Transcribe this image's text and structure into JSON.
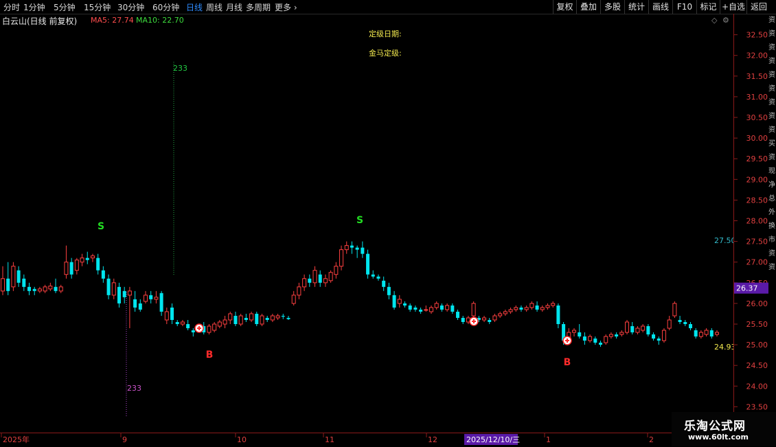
{
  "toolbar": {
    "periods": [
      "分时",
      "1分钟",
      "5分钟",
      "15分钟",
      "30分钟",
      "60分钟",
      "日线",
      "周线",
      "月线",
      "多周期",
      "更多"
    ],
    "active_period": "日线",
    "right_buttons": [
      "复权",
      "叠加",
      "多股",
      "统计",
      "画线",
      "F10",
      "标记",
      "+自选",
      "返回"
    ]
  },
  "info": {
    "title": "白云山(日线 前复权)",
    "ma5": "MA5: 27.74",
    "ma10": "MA10: 22.70"
  },
  "labels": {
    "rating_date": "定级日期:",
    "rating": "金马定级:"
  },
  "colors": {
    "up": "#ff4040",
    "down": "#00e5ee",
    "signal_s": "#22dd22",
    "signal_b": "#ff2a2a",
    "grid_axis": "#8b1a1a",
    "current_price_bg": "#5a1aa8"
  },
  "chart_data": {
    "type": "candlestick",
    "ylim": [
      23.0,
      32.7
    ],
    "y_ticks": [
      "32.50",
      "32.00",
      "31.50",
      "31.00",
      "30.50",
      "30.00",
      "29.50",
      "29.00",
      "28.50",
      "28.00",
      "27.50",
      "27.00",
      "26.50",
      "26.00",
      "25.50",
      "25.00",
      "24.50",
      "24.00",
      "23.50"
    ],
    "x_labels": [
      "2025年",
      "9",
      "10",
      "11",
      "12",
      "2025/12/10/三",
      "1",
      "2"
    ],
    "current_price": "26.37",
    "marker_high": "27.50",
    "marker_low": "24.93",
    "vline_labels": [
      "233",
      "233"
    ],
    "signals": [
      {
        "type": "S",
        "near": "2025-08 high"
      },
      {
        "type": "B",
        "near": "2025-09 low"
      },
      {
        "type": "S",
        "near": "2025-11 high"
      },
      {
        "type": "B",
        "near": "2026-01 low"
      }
    ],
    "candles": [
      [
        26.3,
        26.6,
        26.9,
        26.2
      ],
      [
        26.6,
        26.3,
        27.0,
        26.2
      ],
      [
        26.4,
        26.9,
        27.0,
        26.3
      ],
      [
        26.8,
        26.5,
        26.9,
        26.4
      ],
      [
        26.6,
        26.4,
        26.7,
        26.3
      ],
      [
        26.4,
        26.3,
        26.5,
        26.2
      ],
      [
        26.35,
        26.3,
        26.4,
        26.2
      ],
      [
        26.3,
        26.35,
        26.4,
        26.25
      ],
      [
        26.3,
        26.4,
        26.45,
        26.25
      ],
      [
        26.35,
        26.42,
        26.5,
        26.3
      ],
      [
        26.4,
        26.3,
        26.6,
        26.25
      ],
      [
        26.3,
        26.4,
        26.45,
        26.25
      ],
      [
        26.7,
        27.0,
        27.4,
        26.6
      ],
      [
        27.0,
        26.7,
        27.1,
        26.6
      ],
      [
        26.8,
        27.05,
        27.1,
        26.7
      ],
      [
        27.0,
        27.1,
        27.2,
        26.9
      ],
      [
        27.1,
        27.05,
        27.25,
        26.95
      ],
      [
        27.1,
        27.15,
        27.2,
        27.0
      ],
      [
        27.1,
        26.8,
        27.2,
        26.7
      ],
      [
        26.8,
        26.6,
        26.9,
        26.5
      ],
      [
        26.6,
        26.2,
        26.7,
        26.1
      ],
      [
        26.2,
        26.5,
        26.6,
        26.1
      ],
      [
        26.4,
        26.0,
        26.5,
        25.9
      ],
      [
        26.3,
        26.15,
        26.4,
        26.0
      ],
      [
        26.2,
        26.3,
        26.4,
        25.4
      ],
      [
        26.1,
        25.9,
        26.3,
        25.8
      ],
      [
        26.0,
        25.85,
        26.1,
        25.8
      ],
      [
        26.05,
        26.2,
        26.3,
        26.0
      ],
      [
        26.2,
        26.1,
        26.3,
        26.0
      ],
      [
        26.1,
        26.15,
        26.3,
        26.0
      ],
      [
        26.25,
        25.8,
        26.3,
        25.7
      ],
      [
        25.6,
        25.8,
        25.9,
        25.5
      ],
      [
        25.9,
        25.6,
        26.0,
        25.5
      ],
      [
        25.55,
        25.5,
        25.6,
        25.45
      ],
      [
        25.5,
        25.55,
        25.6,
        25.45
      ],
      [
        25.5,
        25.4,
        25.6,
        25.35
      ],
      [
        25.35,
        25.3,
        25.4,
        25.2
      ],
      [
        25.35,
        25.4,
        25.5,
        25.3
      ],
      [
        25.45,
        25.3,
        25.55,
        25.25
      ],
      [
        25.3,
        25.45,
        25.5,
        25.25
      ],
      [
        25.35,
        25.5,
        25.55,
        25.3
      ],
      [
        25.45,
        25.55,
        25.6,
        25.4
      ],
      [
        25.5,
        25.6,
        25.7,
        25.4
      ],
      [
        25.6,
        25.75,
        25.8,
        25.5
      ],
      [
        25.7,
        25.5,
        25.8,
        25.45
      ],
      [
        25.5,
        25.7,
        25.75,
        25.45
      ],
      [
        25.65,
        25.6,
        25.75,
        25.55
      ],
      [
        25.6,
        25.75,
        25.8,
        25.55
      ],
      [
        25.75,
        25.5,
        25.8,
        25.45
      ],
      [
        25.5,
        25.7,
        25.75,
        25.45
      ],
      [
        25.65,
        25.6,
        25.7,
        25.55
      ],
      [
        25.6,
        25.7,
        25.75,
        25.55
      ],
      [
        25.65,
        25.7,
        25.75,
        25.6
      ],
      [
        25.7,
        25.68,
        25.75,
        25.62
      ],
      [
        25.65,
        25.62,
        25.7,
        25.6
      ],
      [
        26.0,
        26.2,
        26.3,
        25.95
      ],
      [
        26.2,
        26.4,
        26.5,
        26.1
      ],
      [
        26.4,
        26.6,
        26.7,
        26.3
      ],
      [
        26.6,
        26.5,
        26.7,
        26.4
      ],
      [
        26.5,
        26.8,
        26.9,
        26.4
      ],
      [
        26.7,
        26.5,
        26.8,
        26.4
      ],
      [
        26.5,
        26.6,
        26.7,
        26.4
      ],
      [
        26.55,
        26.75,
        26.8,
        26.5
      ],
      [
        26.7,
        26.9,
        27.0,
        26.6
      ],
      [
        26.9,
        27.3,
        27.4,
        26.8
      ],
      [
        27.3,
        27.4,
        27.5,
        27.2
      ],
      [
        27.4,
        27.35,
        27.5,
        27.2
      ],
      [
        27.35,
        27.3,
        27.4,
        27.1
      ],
      [
        27.35,
        27.2,
        27.5,
        27.1
      ],
      [
        27.2,
        26.7,
        27.3,
        26.6
      ],
      [
        26.7,
        26.65,
        26.8,
        26.6
      ],
      [
        26.65,
        26.6,
        26.7,
        26.55
      ],
      [
        26.55,
        26.4,
        26.65,
        26.3
      ],
      [
        26.4,
        26.2,
        26.5,
        26.1
      ],
      [
        26.2,
        25.9,
        26.3,
        25.85
      ],
      [
        26.0,
        26.1,
        26.2,
        25.9
      ],
      [
        26.0,
        25.95,
        26.05,
        25.9
      ],
      [
        25.95,
        25.85,
        26.0,
        25.8
      ],
      [
        25.9,
        25.85,
        25.95,
        25.8
      ],
      [
        25.85,
        25.8,
        25.9,
        25.75
      ],
      [
        25.85,
        25.85,
        25.95,
        25.8
      ],
      [
        25.8,
        25.9,
        25.95,
        25.75
      ],
      [
        25.9,
        26.0,
        26.05,
        25.85
      ],
      [
        25.95,
        25.85,
        26.0,
        25.8
      ],
      [
        25.85,
        25.95,
        26.0,
        25.8
      ],
      [
        25.95,
        25.8,
        26.0,
        25.75
      ],
      [
        25.8,
        25.65,
        25.85,
        25.6
      ],
      [
        25.65,
        25.55,
        25.7,
        25.5
      ],
      [
        25.55,
        25.65,
        25.7,
        25.5
      ],
      [
        25.7,
        26.0,
        26.05,
        25.65
      ],
      [
        25.65,
        25.6,
        25.7,
        25.55
      ],
      [
        25.6,
        25.65,
        25.7,
        25.55
      ],
      [
        25.6,
        25.55,
        25.65,
        25.5
      ],
      [
        25.6,
        25.7,
        25.75,
        25.55
      ],
      [
        25.7,
        25.75,
        25.8,
        25.65
      ],
      [
        25.75,
        25.8,
        25.85,
        25.7
      ],
      [
        25.8,
        25.85,
        25.9,
        25.75
      ],
      [
        25.85,
        25.9,
        25.95,
        25.8
      ],
      [
        25.9,
        25.85,
        25.95,
        25.8
      ],
      [
        25.85,
        25.9,
        25.95,
        25.8
      ],
      [
        25.9,
        26.0,
        26.05,
        25.85
      ],
      [
        25.95,
        25.85,
        26.05,
        25.8
      ],
      [
        25.85,
        25.9,
        25.95,
        25.8
      ],
      [
        25.9,
        25.95,
        26.0,
        25.85
      ],
      [
        25.95,
        26.0,
        26.05,
        25.9
      ],
      [
        25.95,
        25.5,
        26.0,
        25.4
      ],
      [
        25.5,
        25.1,
        25.55,
        25.0
      ],
      [
        25.1,
        25.3,
        25.4,
        25.05
      ],
      [
        25.3,
        25.35,
        25.4,
        25.2
      ],
      [
        25.3,
        25.2,
        25.5,
        25.15
      ],
      [
        25.2,
        25.1,
        25.3,
        25.0
      ],
      [
        25.1,
        25.2,
        25.25,
        25.05
      ],
      [
        25.15,
        25.05,
        25.2,
        25.0
      ],
      [
        25.05,
        25.0,
        25.1,
        24.95
      ],
      [
        25.05,
        25.2,
        25.25,
        25.0
      ],
      [
        25.2,
        25.25,
        25.3,
        25.15
      ],
      [
        25.25,
        25.2,
        25.3,
        25.15
      ],
      [
        25.25,
        25.3,
        25.35,
        25.2
      ],
      [
        25.3,
        25.55,
        25.6,
        25.25
      ],
      [
        25.45,
        25.3,
        25.55,
        25.25
      ],
      [
        25.3,
        25.4,
        25.45,
        25.25
      ],
      [
        25.35,
        25.45,
        25.5,
        25.3
      ],
      [
        25.45,
        25.25,
        25.5,
        25.2
      ],
      [
        25.25,
        25.15,
        25.3,
        25.1
      ],
      [
        25.15,
        25.1,
        25.2,
        25.0
      ],
      [
        25.1,
        25.35,
        25.4,
        25.05
      ],
      [
        25.4,
        25.6,
        25.7,
        25.35
      ],
      [
        25.7,
        26.0,
        26.05,
        25.65
      ],
      [
        25.6,
        25.55,
        25.7,
        25.5
      ],
      [
        25.55,
        25.5,
        25.6,
        25.45
      ],
      [
        25.5,
        25.4,
        25.55,
        25.35
      ],
      [
        25.35,
        25.2,
        25.4,
        25.15
      ],
      [
        25.2,
        25.3,
        25.35,
        25.15
      ],
      [
        25.25,
        25.35,
        25.4,
        25.2
      ],
      [
        25.35,
        25.2,
        25.4,
        25.15
      ],
      [
        25.25,
        25.3,
        25.35,
        25.2
      ]
    ]
  },
  "side_strip": [
    "资",
    "资",
    "资",
    "资",
    "资",
    "资",
    "资",
    "资",
    "资",
    "买",
    "资",
    "现",
    "净",
    "总",
    "外",
    "换",
    "市",
    "资",
    "资"
  ],
  "watermark": {
    "title": "乐淘公式网",
    "url": "www.60lt.com"
  }
}
